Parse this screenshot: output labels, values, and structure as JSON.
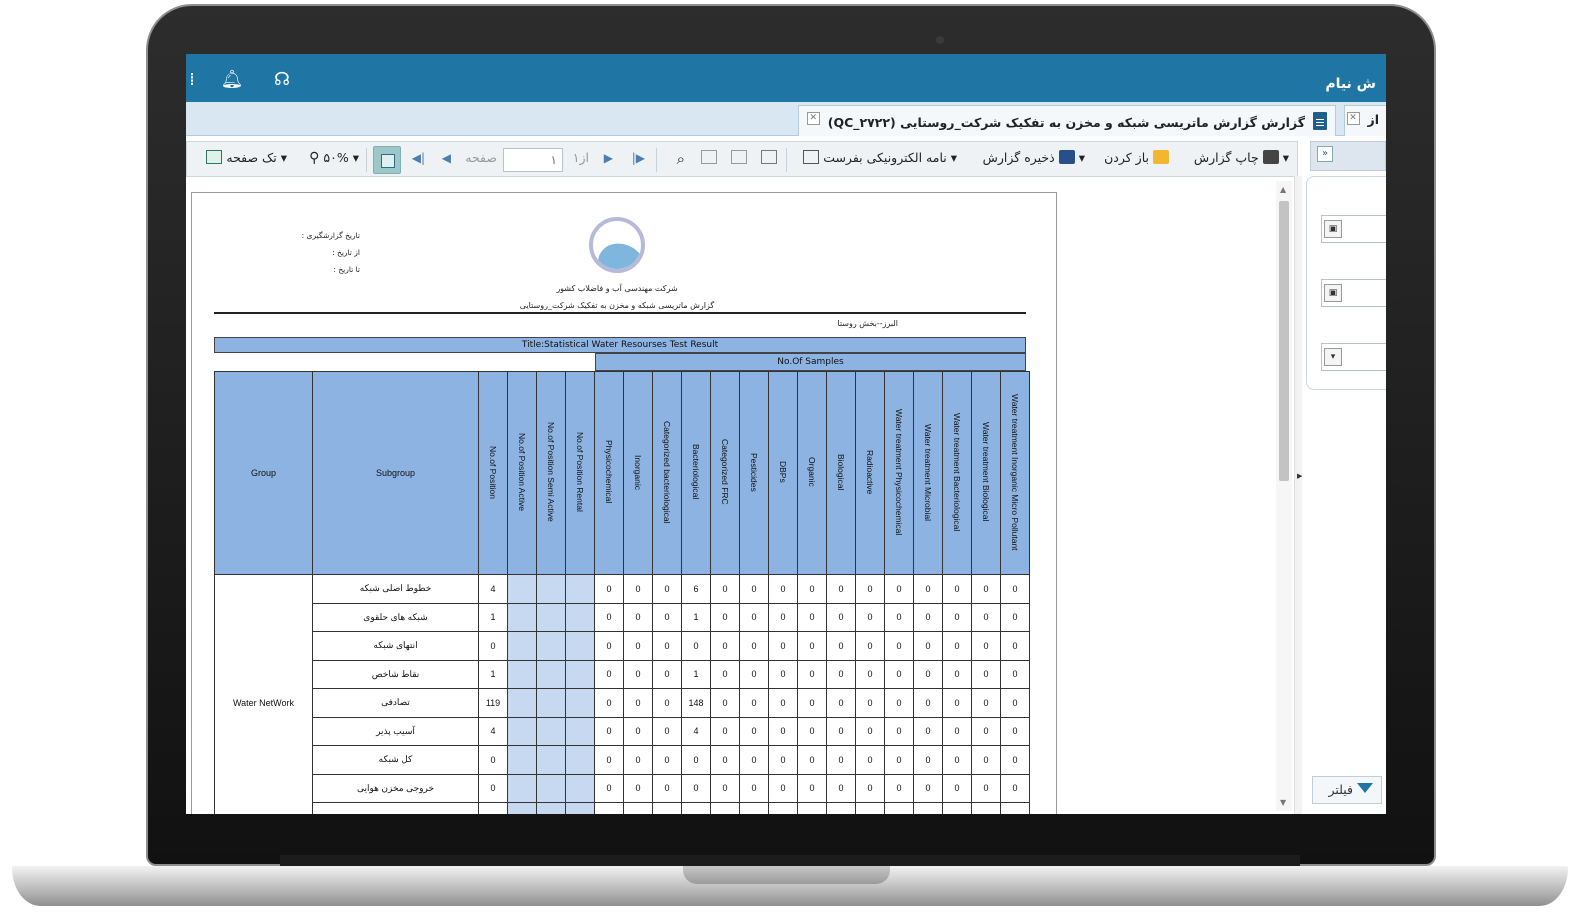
{
  "app": {
    "title": "ش نیام"
  },
  "tabs": [
    {
      "label": "گزارش گزارش ماتریسی شبکه و مخزن به تفکیک شرکت_روستایی (QC_۲۷۲۲)",
      "close": "✕"
    },
    {
      "label": "از",
      "close": "✕"
    }
  ],
  "toolbar": {
    "print": "چاپ گزارش",
    "open": "باز کردن",
    "save": "ذخیره گزارش",
    "email": "نامه الکترونیکی بفرست",
    "page_label": "صفحه",
    "page_value": "۱",
    "page_of": "از۱",
    "zoom": "۵۰%",
    "single_page": "تک صفحه"
  },
  "filter": {
    "label": "فیلتر"
  },
  "report": {
    "meta": [
      "تاریخ گزارشگیری :",
      "از تاریخ :",
      "تا تاریخ :"
    ],
    "company": "شرکت مهندسی آب و فاضلاب کشور",
    "subtitle": "گزارش ماتریسی شبکه و مخزن به تفکیک شرکت_روستایی",
    "region": "البرز--بخش روستا",
    "title": "Title:Statistical Water Resourses Test Result",
    "samples_header": "No.Of Samples",
    "columns": {
      "group": "Group",
      "subgroup": "Subgroup",
      "no_position": "No.of Position",
      "active": "No.of Position Active",
      "semi_active": "No.of Position Semi Active",
      "rental": "No.of Position Rental",
      "samples": [
        "Physicochemical",
        "Inorganic",
        "Categorized bacteriological",
        "Bacteriological",
        "Categorized FRC",
        "Pesticides",
        "DBPs",
        "Organic",
        "Biological",
        "Radioactive",
        "Water treatment Physicochemical",
        "Water treatment Microbial",
        "Water treatment Bacteriological",
        "Water treatment Biological",
        "Water treatment Inorganic Micro Pollutant"
      ]
    },
    "group_label": "Water NetWork",
    "rows": [
      {
        "sub": "خطوط اصلی شبکه",
        "pos": "4",
        "v": [
          "0",
          "0",
          "0",
          "6",
          "0",
          "0",
          "0",
          "0",
          "0",
          "0",
          "0",
          "0",
          "0",
          "0",
          "0"
        ]
      },
      {
        "sub": "شبکه های حلقوی",
        "pos": "1",
        "v": [
          "0",
          "0",
          "0",
          "1",
          "0",
          "0",
          "0",
          "0",
          "0",
          "0",
          "0",
          "0",
          "0",
          "0",
          "0"
        ]
      },
      {
        "sub": "انتهای شبکه",
        "pos": "0",
        "v": [
          "0",
          "0",
          "0",
          "0",
          "0",
          "0",
          "0",
          "0",
          "0",
          "0",
          "0",
          "0",
          "0",
          "0",
          "0"
        ]
      },
      {
        "sub": "نقاط شاخص",
        "pos": "1",
        "v": [
          "0",
          "0",
          "0",
          "1",
          "0",
          "0",
          "0",
          "0",
          "0",
          "0",
          "0",
          "0",
          "0",
          "0",
          "0"
        ]
      },
      {
        "sub": "تصادفی",
        "pos": "119",
        "v": [
          "0",
          "0",
          "0",
          "148",
          "0",
          "0",
          "0",
          "0",
          "0",
          "0",
          "0",
          "0",
          "0",
          "0",
          "0"
        ]
      },
      {
        "sub": "آسیب پذیر",
        "pos": "4",
        "v": [
          "0",
          "0",
          "0",
          "4",
          "0",
          "0",
          "0",
          "0",
          "0",
          "0",
          "0",
          "0",
          "0",
          "0",
          "0"
        ]
      },
      {
        "sub": "کل شبکه",
        "pos": "0",
        "v": [
          "0",
          "0",
          "0",
          "0",
          "0",
          "0",
          "0",
          "0",
          "0",
          "0",
          "0",
          "0",
          "0",
          "0",
          "0"
        ]
      },
      {
        "sub": "خروجی مخزن هوایی",
        "pos": "0",
        "v": [
          "0",
          "0",
          "0",
          "0",
          "0",
          "0",
          "0",
          "0",
          "0",
          "0",
          "0",
          "0",
          "0",
          "0",
          "0"
        ]
      }
    ]
  }
}
